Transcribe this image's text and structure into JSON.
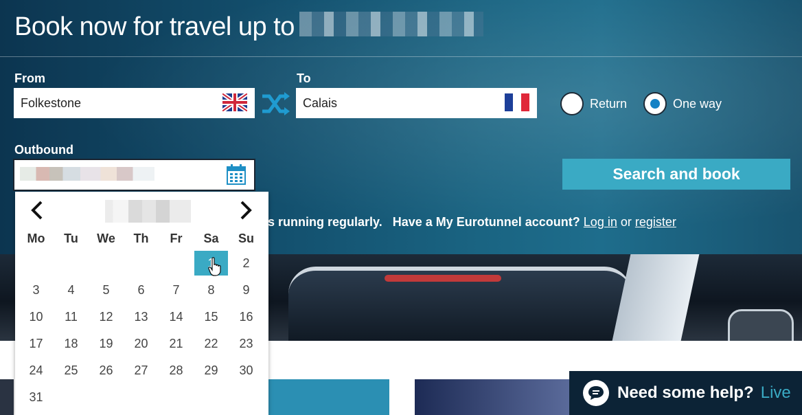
{
  "header": {
    "title": "Book now for travel up to"
  },
  "form": {
    "from_label": "From",
    "from_value": "Folkestone",
    "to_label": "To",
    "to_value": "Calais",
    "return_label": "Return",
    "oneway_label": "One way",
    "selected_trip_type": "One way",
    "outbound_label": "Outbound",
    "search_button": "Search and book"
  },
  "notice": {
    "text_fragment": "s running regularly.",
    "account_question": "Have a My Eurotunnel account?",
    "login_link": "Log in",
    "or_text": "or",
    "register_link": "register"
  },
  "calendar": {
    "weekdays": [
      "Mo",
      "Tu",
      "We",
      "Th",
      "Fr",
      "Sa",
      "Su"
    ],
    "selected_day": "1",
    "weeks": [
      [
        "",
        "",
        "",
        "",
        "",
        "1",
        "2"
      ],
      [
        "3",
        "4",
        "5",
        "6",
        "7",
        "8",
        "9"
      ],
      [
        "10",
        "11",
        "12",
        "13",
        "14",
        "15",
        "16"
      ],
      [
        "17",
        "18",
        "19",
        "20",
        "21",
        "22",
        "23"
      ],
      [
        "24",
        "25",
        "26",
        "27",
        "28",
        "29",
        "30"
      ],
      [
        "31",
        "",
        "",
        "",
        "",
        "",
        ""
      ]
    ]
  },
  "help": {
    "text": "Need some help?",
    "live": "Live"
  },
  "colors": {
    "accent": "#3aaac4",
    "radio_selected": "#1482c5",
    "help_bg": "#0c2336"
  },
  "icons": [
    "uk-flag-icon",
    "france-flag-icon",
    "swap-icon",
    "calendar-icon",
    "chevron-left-icon",
    "chevron-right-icon",
    "chat-bubble-icon",
    "hand-cursor-icon"
  ]
}
